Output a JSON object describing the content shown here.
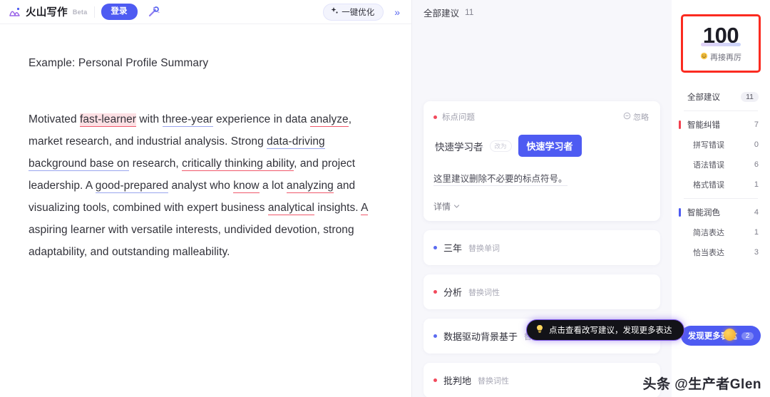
{
  "header": {
    "brand_name": "火山写作",
    "beta_badge": "Beta",
    "login_label": "登录",
    "wand_icon": "magic-wand-icon",
    "optimize_label": "一键优化",
    "optimize_icon": "sparkle-icon",
    "collapse_icon": "double-chevron-right-icon"
  },
  "document": {
    "title": "Example: Personal Profile Summary",
    "paragraph_segments": [
      {
        "text": "Motivated ",
        "mark": "none"
      },
      {
        "text": "fast-learner",
        "mark": "red-highlight"
      },
      {
        "text": " with ",
        "mark": "none"
      },
      {
        "text": "three-year",
        "mark": "blue"
      },
      {
        "text": " experience in data ",
        "mark": "none"
      },
      {
        "text": "analyze",
        "mark": "red"
      },
      {
        "text": ", market research, and industrial analysis. Strong ",
        "mark": "none"
      },
      {
        "text": "data-driving background base on",
        "mark": "blue"
      },
      {
        "text": " research, ",
        "mark": "none"
      },
      {
        "text": "critically thinking ability",
        "mark": "red"
      },
      {
        "text": ", and project leadership. A ",
        "mark": "none"
      },
      {
        "text": "good-prepared",
        "mark": "blue"
      },
      {
        "text": " analyst who ",
        "mark": "none"
      },
      {
        "text": "know",
        "mark": "red"
      },
      {
        "text": " a lot ",
        "mark": "none"
      },
      {
        "text": "analyzing",
        "mark": "red"
      },
      {
        "text": " and visualizing tools, combined with expert business ",
        "mark": "none"
      },
      {
        "text": "analytical",
        "mark": "red"
      },
      {
        "text": " insights. ",
        "mark": "none"
      },
      {
        "text": "A",
        "mark": "red"
      },
      {
        "text": " aspiring learner with versatile interests, undivided devotion, strong adaptability, and outstanding malleability.",
        "mark": "none"
      }
    ]
  },
  "suggestions_panel": {
    "header_label": "全部建议",
    "header_count": "11",
    "active_card": {
      "tag": "标点问题",
      "tag_dot_color": "#f24a5c",
      "ignore_label": "忽略",
      "ignore_icon": "circle-minus-icon",
      "original_word": "快速学习者",
      "change_pill": "改为",
      "replacement_word": "快速学习者",
      "description": "这里建议删除不必要的标点符号。",
      "more_label": "详情",
      "more_icon": "chevron-down-icon"
    },
    "rows": [
      {
        "word": "三年",
        "kind": "替换单词",
        "dot_color": "#5b6bf0"
      },
      {
        "word": "分析",
        "kind": "替换词性",
        "dot_color": "#f24a5c"
      },
      {
        "word": "数据驱动背景基于",
        "kind": "替换单词",
        "dot_color": "#5b6bf0"
      },
      {
        "word": "批判地",
        "kind": "替换词性",
        "dot_color": "#f24a5c"
      }
    ],
    "tooltip": {
      "icon": "lightbulb-icon",
      "text": "点击查看改写建议，发现更多表达"
    }
  },
  "sidebar": {
    "score": "100",
    "score_label": "再接再厉",
    "score_emoji": "emoji-grin-icon",
    "nav": [
      {
        "label": "全部建议",
        "count": "11",
        "style": "pill",
        "marker": "none",
        "level": "top"
      },
      {
        "label": "智能纠错",
        "count": "7",
        "style": "plain",
        "marker": "red",
        "level": "top"
      },
      {
        "label": "拼写错误",
        "count": "0",
        "style": "plain",
        "marker": "none",
        "level": "sub"
      },
      {
        "label": "语法错误",
        "count": "6",
        "style": "plain",
        "marker": "none",
        "level": "sub"
      },
      {
        "label": "格式错误",
        "count": "1",
        "style": "plain",
        "marker": "none",
        "level": "sub"
      },
      {
        "label": "智能润色",
        "count": "4",
        "style": "plain",
        "marker": "blue",
        "level": "top"
      },
      {
        "label": "简洁表达",
        "count": "1",
        "style": "plain",
        "marker": "none",
        "level": "sub"
      },
      {
        "label": "恰当表达",
        "count": "3",
        "style": "plain",
        "marker": "none",
        "level": "sub"
      }
    ],
    "discover": {
      "label": "发现更多表达",
      "count": "2"
    }
  },
  "watermark": "头条 @生产者Glen",
  "colors": {
    "accent": "#4e5bf2",
    "error": "#f24a5c",
    "highlight_bg": "#fde0e4",
    "annotation_box": "#fb2b20",
    "panel_bg": "#f7f7fb"
  }
}
